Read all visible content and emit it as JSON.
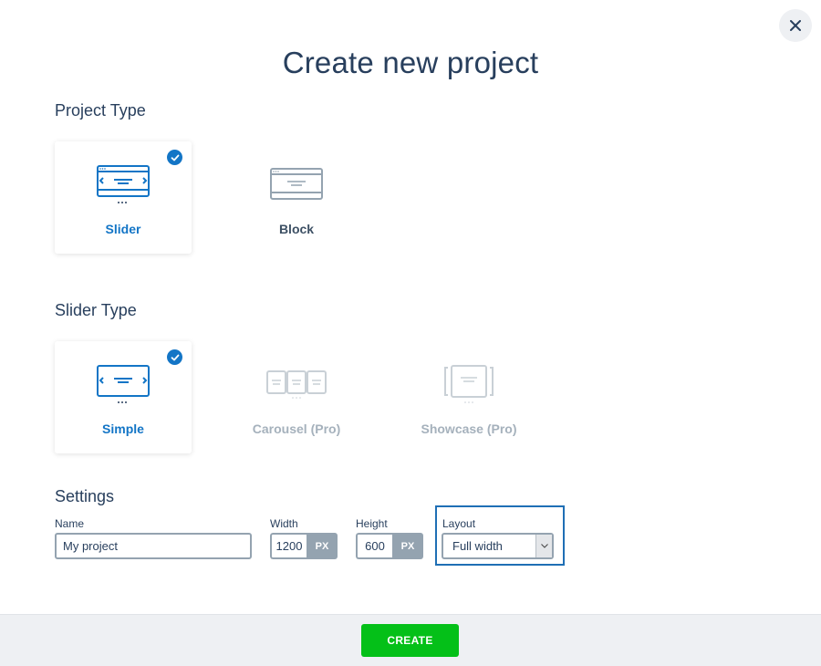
{
  "dialog": {
    "title": "Create new project",
    "close_icon": "close-icon"
  },
  "project_type": {
    "heading": "Project Type",
    "options": [
      {
        "label": "Slider",
        "icon": "slider-icon",
        "selected": true,
        "disabled": false
      },
      {
        "label": "Block",
        "icon": "block-icon",
        "selected": false,
        "disabled": false
      }
    ]
  },
  "slider_type": {
    "heading": "Slider Type",
    "options": [
      {
        "label": "Simple",
        "icon": "simple-slider-icon",
        "selected": true,
        "disabled": false
      },
      {
        "label": "Carousel (Pro)",
        "icon": "carousel-icon",
        "selected": false,
        "disabled": true
      },
      {
        "label": "Showcase (Pro)",
        "icon": "showcase-icon",
        "selected": false,
        "disabled": true
      }
    ]
  },
  "settings": {
    "heading": "Settings",
    "name": {
      "label": "Name",
      "value": "My project"
    },
    "width": {
      "label": "Width",
      "value": "1200",
      "unit": "PX"
    },
    "height": {
      "label": "Height",
      "value": "600",
      "unit": "PX"
    },
    "layout": {
      "label": "Layout",
      "selected": "Full width"
    }
  },
  "footer": {
    "create_label": "CREATE"
  },
  "colors": {
    "accent": "#1375c6",
    "create": "#04c018",
    "text": "#283f5d",
    "disabled": "#a5b1bc"
  }
}
